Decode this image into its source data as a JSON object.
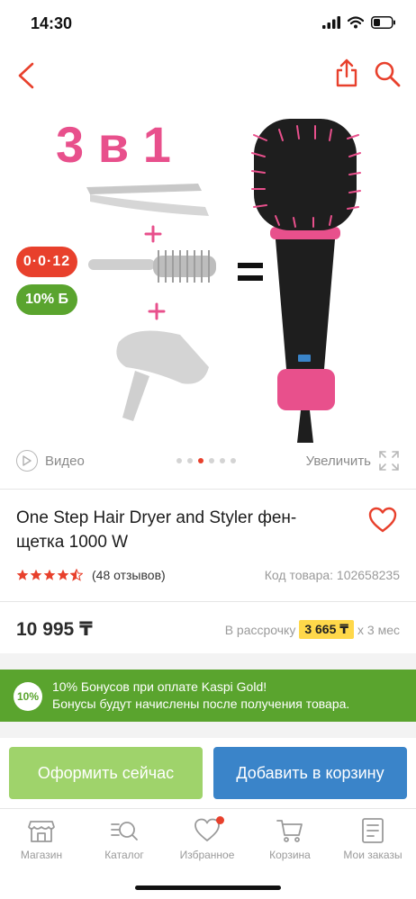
{
  "status_bar": {
    "time": "14:30"
  },
  "product": {
    "image": {
      "headline": "3 в 1",
      "badge_installment": "0·0·12",
      "badge_bonus": "10% Б",
      "accent_pink": "#e8508c",
      "brush_color": "#1e1e1e"
    },
    "video_label": "Видео",
    "zoom_label": "Увеличить",
    "slides": {
      "count": 6,
      "active_index": 2
    },
    "title": "One Step Hair Dryer and Styler фен-щетка 1000 W",
    "rating": {
      "stars": 4.5,
      "reviews_label": "(48 отзывов)"
    },
    "code_label": "Код товара: 102658235",
    "price": "10 995 ₸",
    "installment": {
      "prefix": "В рассрочку",
      "amount": "3 665 ₸",
      "suffix": "х 3 мес"
    }
  },
  "bonus_banner": {
    "badge": "10%",
    "line1": "10% Бонусов при оплате Kaspi Gold!",
    "line2": "Бонусы будут начислены после получения товара."
  },
  "actions": {
    "order_now": "Оформить сейчас",
    "add_to_cart": "Добавить в корзину"
  },
  "tabbar": {
    "items": [
      {
        "label": "Магазин",
        "icon": "store-icon"
      },
      {
        "label": "Каталог",
        "icon": "catalog-icon"
      },
      {
        "label": "Избранное",
        "icon": "heart-icon"
      },
      {
        "label": "Корзина",
        "icon": "cart-icon"
      },
      {
        "label": "Мои заказы",
        "icon": "orders-icon"
      }
    ]
  },
  "colors": {
    "accent_red": "#e8402c",
    "kaspi_green": "#5aa42e",
    "order_green": "#9fd36b",
    "cart_blue": "#3a84c9",
    "installment_yellow": "#ffd84a"
  }
}
